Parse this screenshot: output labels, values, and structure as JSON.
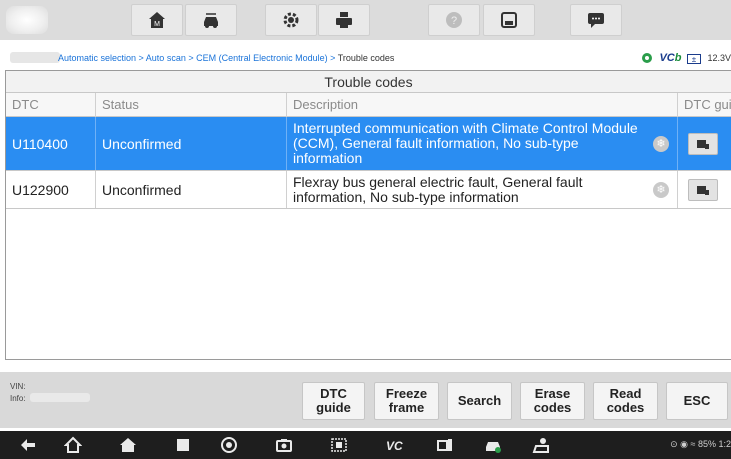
{
  "breadcrumb": {
    "path": "Automatic selection > Auto scan > CEM (Central Electronic Module) > ",
    "current": "Trouble codes",
    "vc_label": "VC",
    "vc_suffix": "b",
    "voltage": "12.3V"
  },
  "panel": {
    "title": "Trouble codes",
    "columns": [
      "DTC",
      "Status",
      "Description",
      "DTC guide"
    ]
  },
  "rows": [
    {
      "dtc": "U110400",
      "status": "Unconfirmed",
      "description": "Interrupted communication with Climate Control Module (CCM), General fault information, No sub-type information"
    },
    {
      "dtc": "U122900",
      "status": "Unconfirmed",
      "description": "Flexray bus general electric fault, General fault information, No sub-type information"
    }
  ],
  "footer": {
    "vin_label": "VIN:",
    "info_label": "Info:"
  },
  "actions": {
    "dtc_guide": "DTC guide",
    "freeze_frame": "Freeze frame",
    "search": "Search",
    "erase_codes": "Erase codes",
    "read_codes": "Read codes",
    "esc": "ESC"
  },
  "status_bar": {
    "text": "85% 1:2"
  },
  "colors": {
    "selected_row": "#2a8df2",
    "breadcrumb_link": "#1a73d9"
  },
  "icons": [
    "home-icon",
    "vehicle-switch-icon",
    "settings-icon",
    "print-icon",
    "help-icon",
    "save-icon",
    "message-icon"
  ]
}
